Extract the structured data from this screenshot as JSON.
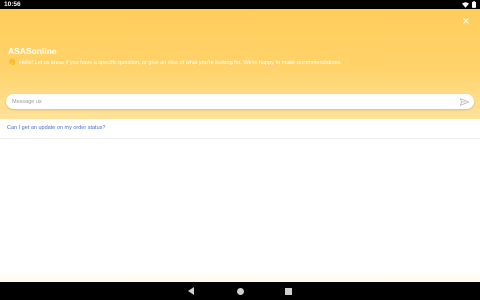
{
  "status_bar": {
    "time": "10:56",
    "icons": [
      "wifi-icon",
      "battery-icon"
    ]
  },
  "header": {
    "title": "ASASonline",
    "greeting_emoji": "👋",
    "greeting_text": "Hello! Let us know if you have a specific question, or give an idea of what you're looking for. We're happy to make recommendations.",
    "close_icon": "close-icon",
    "background_color": "#ffcd5a"
  },
  "message": {
    "placeholder": "Message us",
    "send_icon": "send-icon"
  },
  "suggestions": [
    {
      "label": "Can I get an update on my order status?"
    }
  ],
  "navigation": {
    "icons": [
      "back-icon",
      "home-icon",
      "recent-apps-icon"
    ]
  },
  "colors": {
    "accent": "#ffcd5a",
    "link": "#4a6fd8"
  }
}
